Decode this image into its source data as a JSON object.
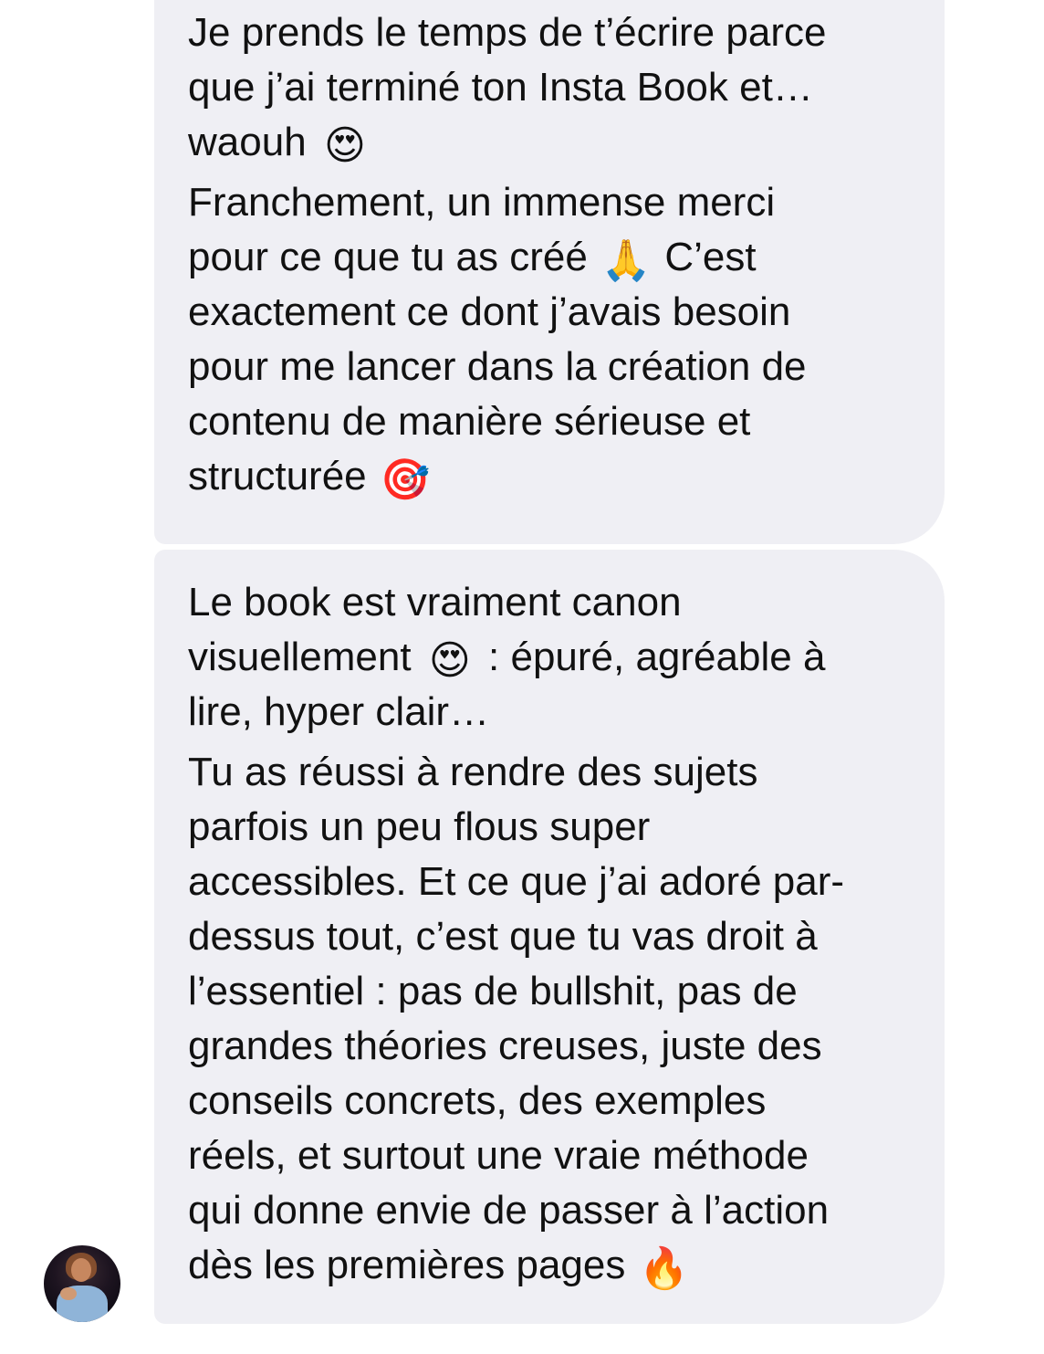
{
  "messages": [
    {
      "paragraphs": [
        {
          "lines": [
            {
              "text": "Je prends le temps de t’écrire parce"
            },
            {
              "text": "que j’ai terminé ton Insta Book et…"
            },
            {
              "text": "waouh",
              "emoji": "😍",
              "after": ""
            }
          ]
        },
        {
          "lines": [
            {
              "text": "Franchement, un immense merci"
            },
            {
              "text": "pour ce que tu as créé",
              "emoji": "🙏",
              "after": "C’est"
            },
            {
              "text": "exactement ce dont j’avais besoin"
            },
            {
              "text": "pour me lancer dans la création de"
            },
            {
              "text": "contenu de manière sérieuse et"
            },
            {
              "text": "structurée",
              "emoji": "🎯",
              "after": ""
            }
          ]
        }
      ]
    },
    {
      "paragraphs": [
        {
          "lines": [
            {
              "text": "Le book est vraiment canon"
            },
            {
              "text": "visuellement",
              "emoji": "😍",
              "after": ": épuré, agréable à"
            },
            {
              "text": "lire, hyper clair…"
            }
          ]
        },
        {
          "lines": [
            {
              "text": "Tu as réussi à rendre des sujets"
            },
            {
              "text": "parfois un peu flous super"
            },
            {
              "text": "accessibles. Et ce que j’ai adoré par-"
            },
            {
              "text": "dessus tout, c’est que tu vas droit à"
            },
            {
              "text": "l’essentiel : pas de bullshit, pas de"
            },
            {
              "text": "grandes théories creuses, juste des"
            },
            {
              "text": "conseils concrets, des exemples"
            },
            {
              "text": "réels, et surtout une vraie méthode"
            },
            {
              "text": "qui donne envie de passer à l’action"
            },
            {
              "text": "dès les premières pages",
              "emoji": "🔥",
              "after": ""
            }
          ]
        }
      ]
    }
  ],
  "sender": {
    "avatar_icon": "sender-avatar-icon"
  },
  "colors": {
    "bubble_background": "#efeff4",
    "text": "#111111",
    "page_background": "#ffffff"
  }
}
